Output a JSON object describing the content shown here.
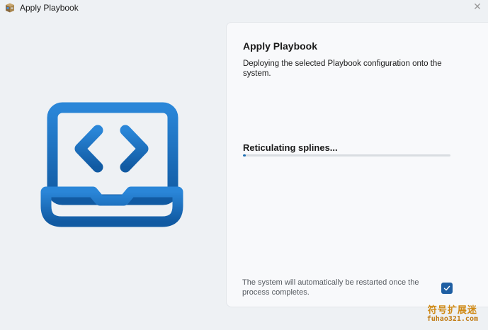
{
  "window": {
    "title": "Apply Playbook",
    "icon": "package-icon",
    "close_glyph": "✕"
  },
  "illustration": {
    "icon": "laptop-code-icon",
    "accent": "#1b6fc0"
  },
  "panel": {
    "title": "Apply Playbook",
    "description": "Deploying the selected Playbook configuration onto the system.",
    "status": "Reticulating splines...",
    "progress": 0.01,
    "restart_note": "The system will automatically be restarted once the process completes.",
    "auto_restart_checked": true
  },
  "watermark": {
    "line1": "符号扩展迷",
    "line2": "fuhao321.com"
  },
  "colors": {
    "background": "#eef1f4",
    "card": "#f8f9fb",
    "accent": "#1f6fb3",
    "watermark": "#d08a16"
  }
}
